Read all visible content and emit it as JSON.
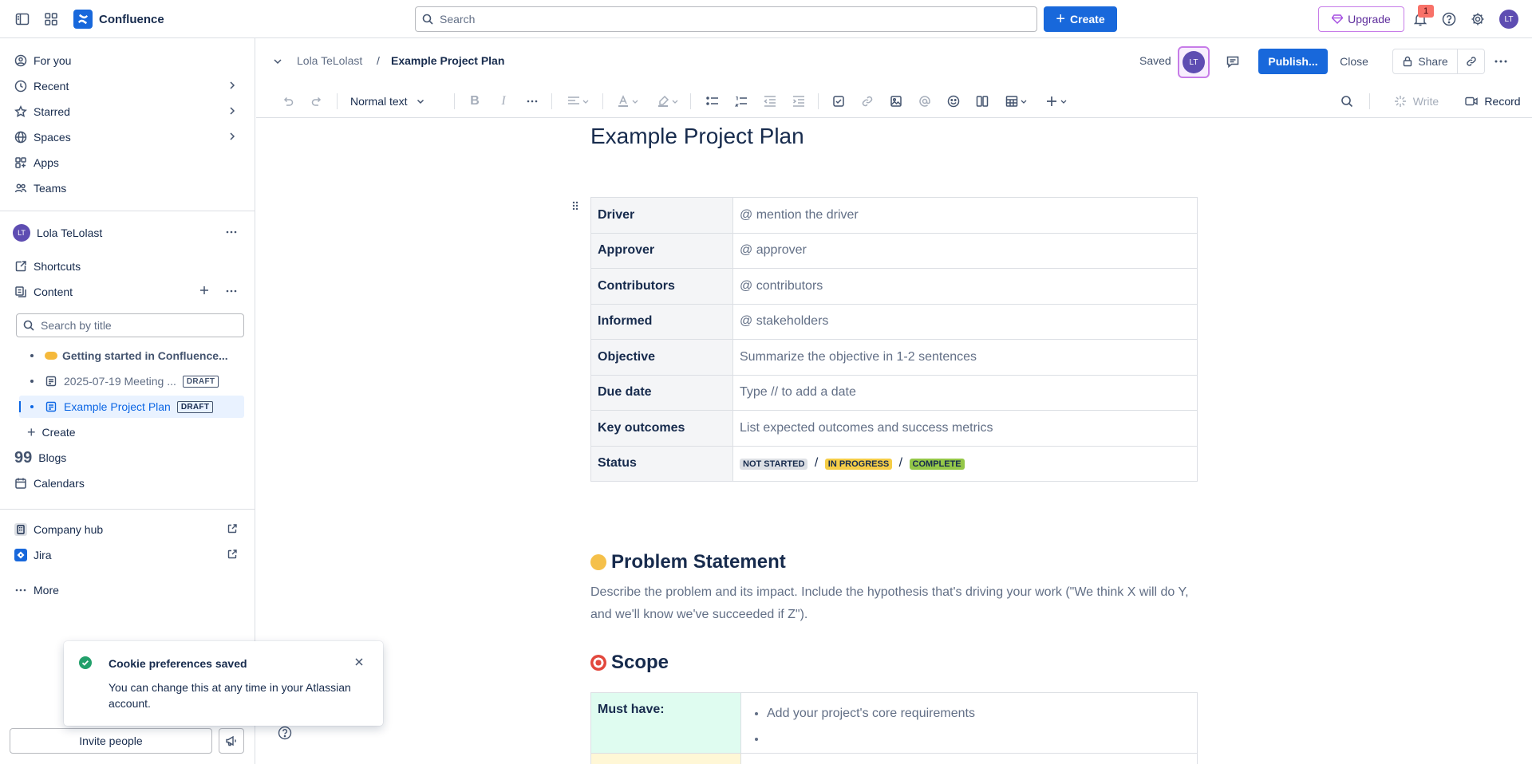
{
  "topbar": {
    "app_name": "Confluence",
    "search_placeholder": "Search",
    "create_label": "Create",
    "upgrade_label": "Upgrade",
    "notification_count": "1",
    "user_initials": "LT"
  },
  "sidebar": {
    "nav": [
      {
        "label": "For you",
        "icon": "home-icon"
      },
      {
        "label": "Recent",
        "icon": "clock-icon"
      },
      {
        "label": "Starred",
        "icon": "star-icon"
      },
      {
        "label": "Spaces",
        "icon": "globe-icon"
      },
      {
        "label": "Apps",
        "icon": "apps-icon"
      },
      {
        "label": "Teams",
        "icon": "people-icon"
      }
    ],
    "space": {
      "initials": "LT",
      "name": "Lola TeLolast",
      "shortcuts_label": "Shortcuts",
      "content_label": "Content",
      "search_placeholder": "Search by title",
      "tree": [
        {
          "title": "Getting started in Confluence...",
          "draft": "",
          "icon": "handshake-emoji"
        },
        {
          "title": "2025-07-19 Meeting ...",
          "draft": "DRAFT",
          "icon": "page-icon"
        },
        {
          "title": "Example Project Plan",
          "draft": "DRAFT",
          "icon": "page-icon",
          "active": true
        }
      ],
      "create_label": "Create",
      "blogs_label": "Blogs",
      "calendars_label": "Calendars"
    },
    "apps": [
      {
        "label": "Company hub",
        "icon": "building-icon"
      },
      {
        "label": "Jira",
        "icon": "jira-icon"
      }
    ],
    "more_label": "More",
    "invite_label": "Invite people"
  },
  "toast": {
    "title": "Cookie preferences saved",
    "body": "You can change this at any time in your Atlassian account."
  },
  "header": {
    "breadcrumb_parent": "Lola TeLolast",
    "breadcrumb_sep": "/",
    "breadcrumb_current": "Example Project Plan",
    "saved_label": "Saved",
    "collab_initials": "LT",
    "publish_label": "Publish...",
    "close_label": "Close",
    "share_label": "Share"
  },
  "toolbar": {
    "text_style": "Normal text",
    "write_label": "Write",
    "record_label": "Record"
  },
  "document": {
    "title": "Example Project Plan",
    "info_rows": [
      {
        "key": "Driver",
        "value": "@ mention the driver"
      },
      {
        "key": "Approver",
        "value": "@ approver"
      },
      {
        "key": "Contributors",
        "value": "@ contributors"
      },
      {
        "key": "Informed",
        "value": "@ stakeholders"
      },
      {
        "key": "Objective",
        "value": "Summarize the objective in 1-2 sentences"
      },
      {
        "key": "Due date",
        "value": "Type // to add a date"
      },
      {
        "key": "Key outcomes",
        "value": "List expected outcomes and success metrics"
      },
      {
        "key": "Status",
        "value": ""
      }
    ],
    "status": {
      "not_started": "NOT STARTED",
      "in_progress": "IN PROGRESS",
      "complete": "COMPLETE",
      "sep": "/"
    },
    "problem_heading": "Problem Statement",
    "problem_text": "Describe the problem and its impact. Include the hypothesis that's driving your work (\"We think X will do Y, and we'll know we've succeeded if Z\").",
    "scope_heading": "Scope",
    "scope_rows": [
      {
        "key": "Must have:",
        "bullets": [
          "Add your project's core requirements",
          ""
        ]
      }
    ]
  },
  "colors": {
    "brand_blue": "#1868db",
    "upgrade_purple": "#c77ce8",
    "lozenge_grey": "#dcdfe4",
    "lozenge_yellow": "#f5cd47",
    "lozenge_green": "#94c748",
    "must_have_bg": "#dffcf0",
    "success_green": "#22a06b"
  }
}
